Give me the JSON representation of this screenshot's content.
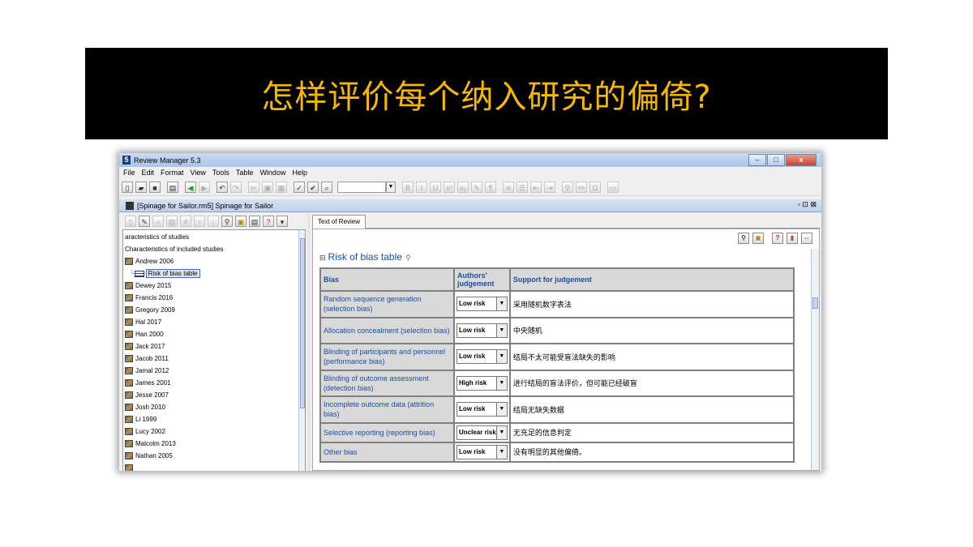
{
  "slide": {
    "title": "怎样评价每个纳入研究的偏倚?"
  },
  "window": {
    "app_title": "Review Manager 5.3",
    "app_icon_glyph": "5",
    "minimize_glyph": "–",
    "maximize_glyph": "□",
    "close_glyph": "x",
    "menu": [
      {
        "u": "F",
        "rest": "ile"
      },
      {
        "u": "E",
        "rest": "dit"
      },
      {
        "u": "",
        "pre": "F",
        "u2": "o",
        "rest": "rmat"
      },
      {
        "u": "V",
        "rest": "iew"
      },
      {
        "u": "T",
        "rest": "ools"
      },
      {
        "u": "",
        "pre": "T",
        "u2": "a",
        "rest": "ble"
      },
      {
        "u": "W",
        "rest": "indow"
      },
      {
        "u": "H",
        "rest": "elp"
      }
    ],
    "menu_labels": [
      "File",
      "Edit",
      "Format",
      "View",
      "Tools",
      "Table",
      "Window",
      "Help"
    ],
    "format_buttons": [
      "B",
      "I",
      "U"
    ]
  },
  "document": {
    "title": "[Spinage for Sailor.rm5] Spinage for Sailor",
    "controls": "▫ ⊡ ⊠"
  },
  "tree": {
    "items": [
      {
        "label": "aracteristics of studies",
        "type": "text"
      },
      {
        "label": "Characteristics of included studies",
        "type": "text"
      },
      {
        "label": "Andrew 2006",
        "type": "study"
      },
      {
        "label": "Risk of bias table",
        "type": "table",
        "selected": true
      },
      {
        "label": "Dewey 2015",
        "type": "study"
      },
      {
        "label": "Francis 2016",
        "type": "study"
      },
      {
        "label": "Gregory 2009",
        "type": "study"
      },
      {
        "label": "Hal 2017",
        "type": "study"
      },
      {
        "label": "Han 2000",
        "type": "study"
      },
      {
        "label": "Jack 2017",
        "type": "study"
      },
      {
        "label": "Jacob 2011",
        "type": "study"
      },
      {
        "label": "Jamal 2012",
        "type": "study"
      },
      {
        "label": "James 2001",
        "type": "study"
      },
      {
        "label": "Jesse 2007",
        "type": "study"
      },
      {
        "label": "Josh 2010",
        "type": "study"
      },
      {
        "label": "Li 1999",
        "type": "study"
      },
      {
        "label": "Lucy 2002",
        "type": "study"
      },
      {
        "label": "Malcolm 2013",
        "type": "study"
      },
      {
        "label": "Nathan 2005",
        "type": "study"
      }
    ]
  },
  "tab": {
    "label": "Text of Review"
  },
  "rob": {
    "heading": "Risk of bias table",
    "expand_glyph": "⊟",
    "headers": {
      "bias": "Bias",
      "judgement": "Authors' judgement",
      "support": "Support for judgement"
    },
    "rows": [
      {
        "bias": "Random sequence generation (selection bias)",
        "judgement": "Low risk",
        "support": "采用随机数字表法"
      },
      {
        "bias": "Allocation concealment (selection bias)",
        "judgement": "Low risk",
        "support": "中央随机"
      },
      {
        "bias": "Blinding of participants and personnel (performance bias)",
        "judgement": "Low risk",
        "support": "结局不太可能受盲法缺失的影响"
      },
      {
        "bias": "Blinding of outcome assessment (detection bias)",
        "judgement": "High risk",
        "support": "进行结局的盲法评价，但可能已经破盲"
      },
      {
        "bias": "Incomplete outcome data (attrition bias)",
        "judgement": "Low risk",
        "support": "结局无缺失数据"
      },
      {
        "bias": "Selective reporting (reporting bias)",
        "judgement": "Unclear risk",
        "support": "无充足的信息判定"
      },
      {
        "bias": "Other bias",
        "judgement": "Low risk",
        "support": "没有明显的其他偏倚。"
      }
    ]
  },
  "colors": {
    "banner_bg": "#000000",
    "banner_text": "#f5b800",
    "link_blue": "#1a4fa0",
    "header_gray": "#d9d9d9"
  }
}
